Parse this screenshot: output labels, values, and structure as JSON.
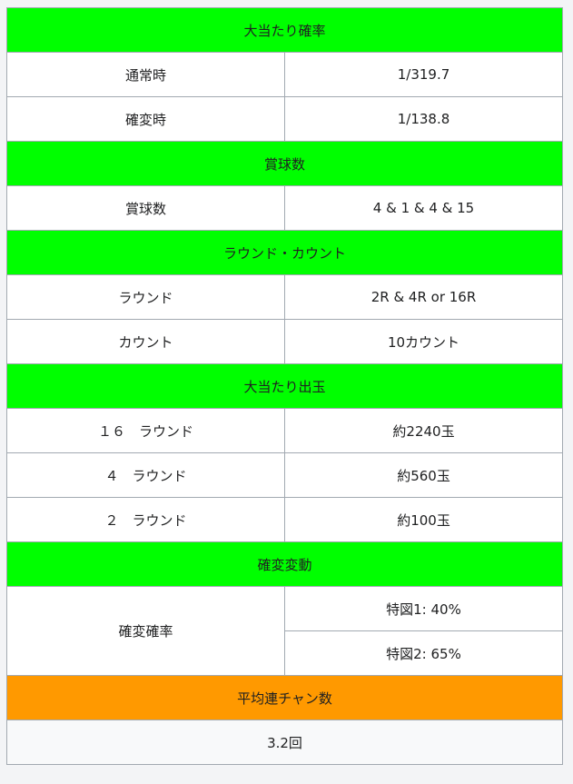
{
  "sections": {
    "probability": {
      "header": "大当たり確率",
      "rows": [
        {
          "label": "通常時",
          "value": "1/319.7"
        },
        {
          "label": "確変時",
          "value": "1/138.8"
        }
      ]
    },
    "prize_balls": {
      "header": "賞球数",
      "rows": [
        {
          "label": "賞球数",
          "value": "4 & 1 & 4 & 15"
        }
      ]
    },
    "round_count": {
      "header": "ラウンド・カウント",
      "rows": [
        {
          "label": "ラウンド",
          "value": "2R & 4R or 16R"
        },
        {
          "label": "カウント",
          "value": "10カウント"
        }
      ]
    },
    "payout": {
      "header": "大当たり出玉",
      "rows": [
        {
          "label": "１６　ラウンド",
          "value": "約2240玉"
        },
        {
          "label": "４　ラウンド",
          "value": "約560玉"
        },
        {
          "label": "２　ラウンド",
          "value": "約100玉"
        }
      ]
    },
    "kakuhen": {
      "header": "確変変動",
      "label": "確変確率",
      "values": [
        "特図1: 40%",
        "特図2: 65%"
      ]
    },
    "average_chain": {
      "header": "平均連チャン数",
      "value": "3.2回"
    }
  },
  "colors": {
    "header_green": "#00ff00",
    "header_orange": "#ff9900",
    "border": "#a2a9b1"
  }
}
